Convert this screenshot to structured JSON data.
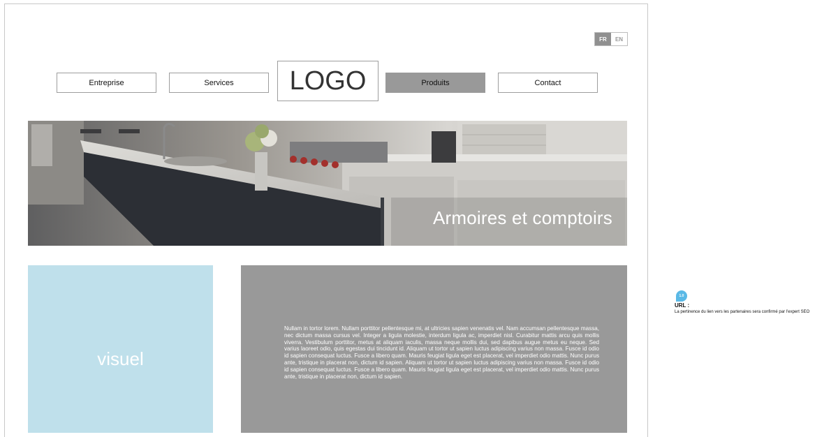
{
  "lang": {
    "fr": "FR",
    "en": "EN"
  },
  "nav": {
    "entreprise": "Entreprise",
    "services": "Services",
    "logo": "LOGO",
    "produits": "Produits",
    "contact": "Contact"
  },
  "hero": {
    "title": "Armoires et comptoirs"
  },
  "content": {
    "visuel": "visuel",
    "paragraph": "Nullam in tortor lorem. Nullam porttitor pellentesque mi, at ultricies sapien venenatis vel. Nam accumsan pellentesque massa, nec dictum massa cursus vel. Integer a ligula molestie, interdum ligula ac, imperdiet nisl. Curabitur mattis arcu quis mollis viverra. Vestibulum porttitor, metus at aliquam iaculis, massa neque mollis dui, sed dapibus augue metus eu neque. Sed varius laoreet odio, quis egestas dui tincidunt id. Aliquam ut tortor ut sapien luctus adipiscing varius non massa. Fusce id odio id sapien consequat luctus. Fusce a libero quam. Mauris feugiat ligula eget est placerat, vel imperdiet odio mattis. Nunc purus ante, tristique in placerat non, dictum id sapien. Aliquam ut tortor ut sapien luctus adipiscing varius non massa. Fusce id odio id sapien consequat luctus. Fusce a libero quam. Mauris feugiat ligula eget est placerat, vel imperdiet odio mattis. Nunc purus ante, tristique in placerat non, dictum id sapien."
  },
  "annotation": {
    "badge": "1.0",
    "title": "URL :",
    "text": "La pertinence du lien vers les partenaires sera confirmé par l'expert SEO"
  },
  "colors": {
    "active_nav": "#999999",
    "visuel_bg": "#bfe0eb",
    "annotation_accent": "#5ab9e6"
  }
}
